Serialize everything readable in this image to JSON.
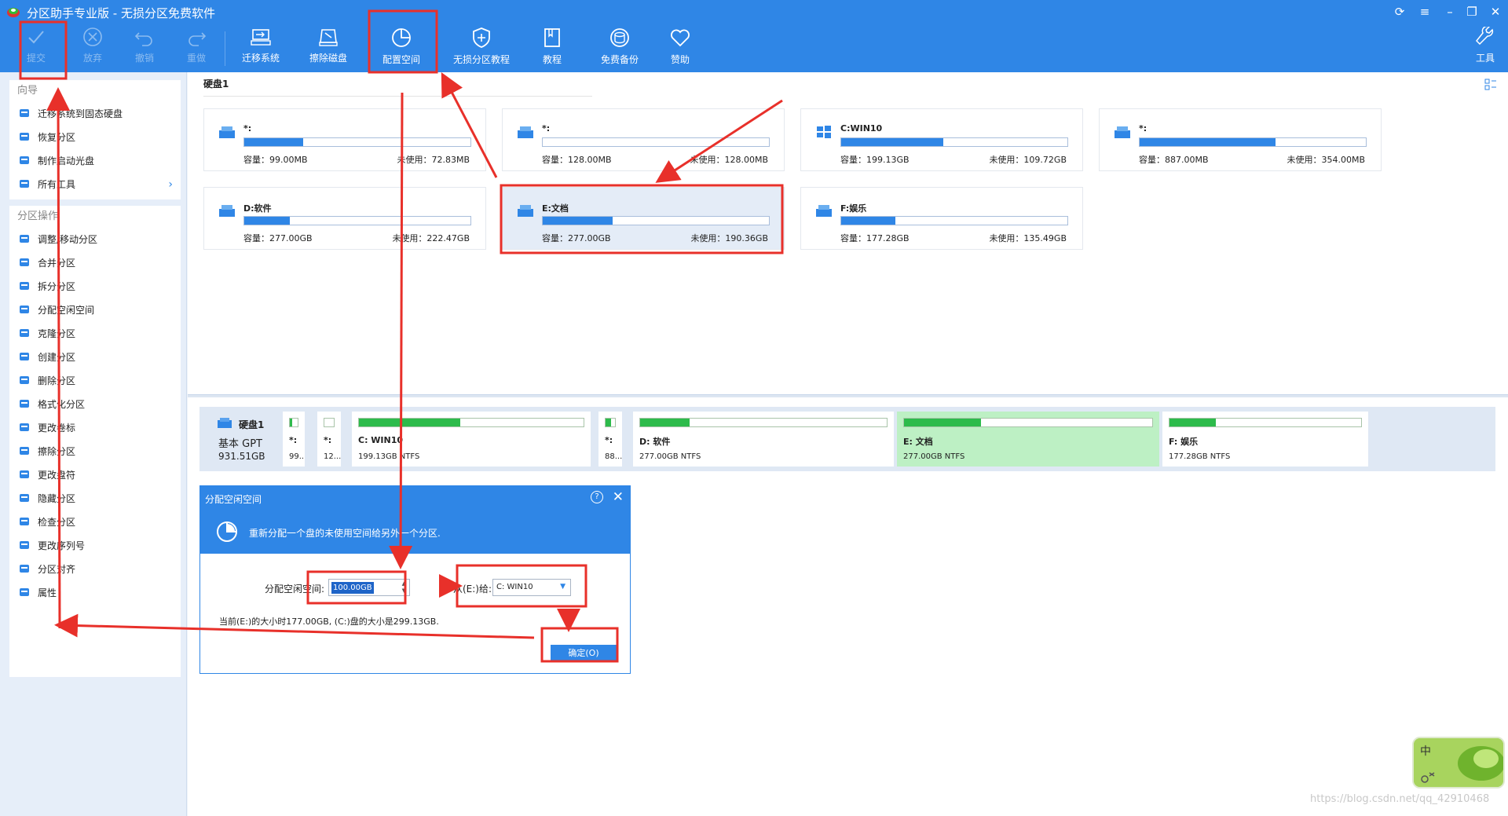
{
  "window": {
    "title": "分区助手专业版 - 无损分区免费软件"
  },
  "toolbar": {
    "commit": "提交",
    "discard": "放弃",
    "undo": "撤销",
    "redo": "重做",
    "migrate": "迁移系统",
    "wipe": "擦除磁盘",
    "allocate": "配置空间",
    "tutorial_lossless": "无损分区教程",
    "tutorial": "教程",
    "backup": "免费备份",
    "donate": "赞助",
    "tools": "工具"
  },
  "sidebar": {
    "wizard_heading": "向导",
    "wizard_items": [
      {
        "label": "迁移系统到固态硬盘",
        "icon": "migrate-icon"
      },
      {
        "label": "恢复分区",
        "icon": "recover-icon"
      },
      {
        "label": "制作启动光盘",
        "icon": "bootdisc-icon"
      },
      {
        "label": "所有工具",
        "icon": "more-icon"
      }
    ],
    "ops_heading": "分区操作",
    "ops_items": [
      {
        "label": "调整/移动分区",
        "icon": "resize-icon"
      },
      {
        "label": "合并分区",
        "icon": "merge-icon"
      },
      {
        "label": "拆分分区",
        "icon": "split-icon"
      },
      {
        "label": "分配空闲空间",
        "icon": "allocate-icon"
      },
      {
        "label": "克隆分区",
        "icon": "clone-icon"
      },
      {
        "label": "创建分区",
        "icon": "create-icon"
      },
      {
        "label": "删除分区",
        "icon": "delete-icon"
      },
      {
        "label": "格式化分区",
        "icon": "format-icon"
      },
      {
        "label": "更改卷标",
        "icon": "label-icon"
      },
      {
        "label": "擦除分区",
        "icon": "wipe-icon"
      },
      {
        "label": "更改盘符",
        "icon": "letter-icon"
      },
      {
        "label": "隐藏分区",
        "icon": "hide-icon"
      },
      {
        "label": "检查分区",
        "icon": "check-icon"
      },
      {
        "label": "更改序列号",
        "icon": "serial-icon"
      },
      {
        "label": "分区对齐",
        "icon": "align-icon"
      },
      {
        "label": "属性",
        "icon": "info-icon"
      }
    ]
  },
  "disk": {
    "title": "硬盘1",
    "name": "硬盘1",
    "type": "基本 GPT",
    "size": "931.51GB"
  },
  "cards": [
    {
      "name": "*:",
      "cap": "容量：99.00MB",
      "free": "未使用：72.83MB",
      "used": 0.26
    },
    {
      "name": "*:",
      "cap": "容量：128.00MB",
      "free": "未使用：128.00MB",
      "used": 0.0
    },
    {
      "name": "C:WIN10",
      "cap": "容量：199.13GB",
      "free": "未使用：109.72GB",
      "used": 0.45
    },
    {
      "name": "*:",
      "cap": "容量：887.00MB",
      "free": "未使用：354.00MB",
      "used": 0.6
    },
    {
      "name": "D:软件",
      "cap": "容量：277.00GB",
      "free": "未使用：222.47GB",
      "used": 0.2
    },
    {
      "name": "E:文档",
      "cap": "容量：277.00GB",
      "free": "未使用：190.36GB",
      "used": 0.31
    },
    {
      "name": "F:娱乐",
      "cap": "容量：177.28GB",
      "free": "未使用：135.49GB",
      "used": 0.24
    }
  ],
  "segments": [
    {
      "name": "*:",
      "info": "99...",
      "used": 0.26
    },
    {
      "name": "*:",
      "info": "12...",
      "used": 0.0
    },
    {
      "name": "C: WIN10",
      "info": "199.13GB NTFS",
      "used": 0.45
    },
    {
      "name": "*:",
      "info": "88...",
      "used": 0.6
    },
    {
      "name": "D: 软件",
      "info": "277.00GB NTFS",
      "used": 0.2
    },
    {
      "name": "E: 文档",
      "info": "277.00GB NTFS",
      "used": 0.31
    },
    {
      "name": "F: 娱乐",
      "info": "177.28GB NTFS",
      "used": 0.24
    }
  ],
  "dialog": {
    "title": "分配空闲空间",
    "help": "?",
    "banner": "重新分配一个盘的未使用空间给另外一个分区.",
    "space_label": "分配空闲空间:",
    "space_value": "100.00GB",
    "to_label": "从(E:)给:",
    "target": "C: WIN10",
    "note": "当前(E:)的大小时177.00GB, (C:)盘的大小是299.13GB.",
    "ok": "确定(O)"
  },
  "widget": {
    "text": "中"
  },
  "watermark": "https://blog.csdn.net/qq_42910468",
  "colors": {
    "accent": "#2f86e6",
    "annotation": "#e8302a",
    "segment_fill": "#2dbb4b"
  }
}
